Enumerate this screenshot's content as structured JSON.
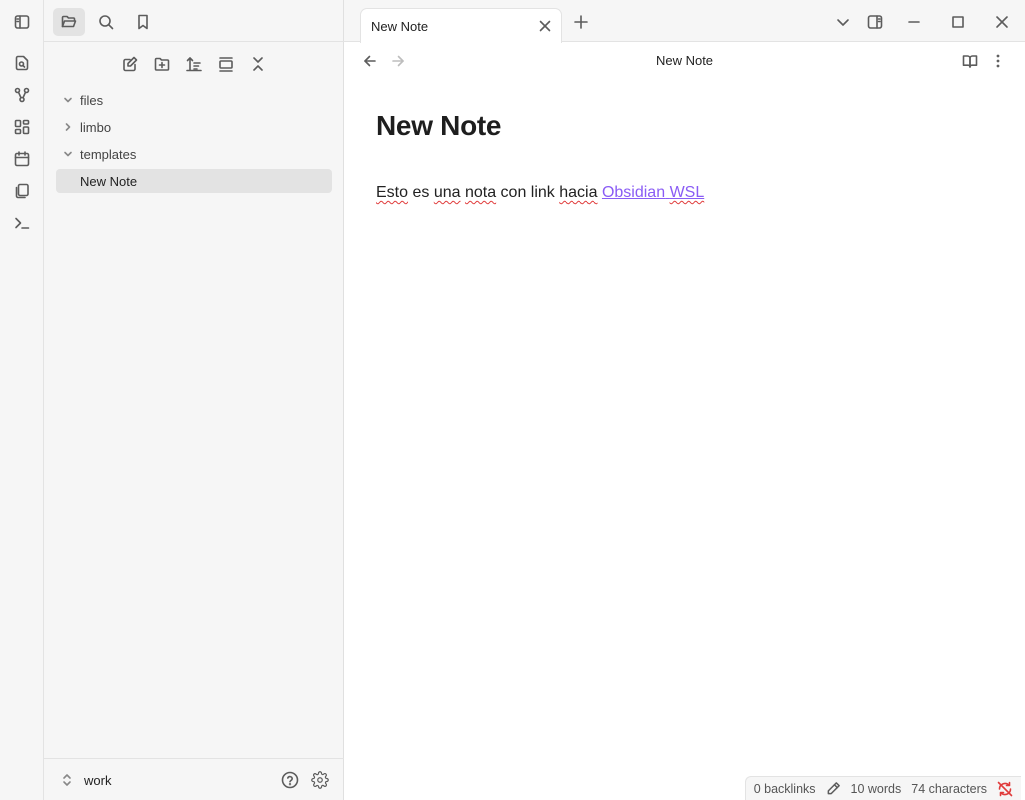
{
  "ribbon": {
    "items": [
      {
        "name": "switcher-icon"
      },
      {
        "name": "graph-icon"
      },
      {
        "name": "canvas-icon"
      },
      {
        "name": "daily-note-icon"
      },
      {
        "name": "templates-icon"
      },
      {
        "name": "command-palette-icon"
      }
    ]
  },
  "sidebar": {
    "tree": [
      {
        "label": "files",
        "type": "folder",
        "expanded": true
      },
      {
        "label": "limbo",
        "type": "folder",
        "expanded": false
      },
      {
        "label": "templates",
        "type": "folder",
        "expanded": true
      },
      {
        "label": "New Note",
        "type": "file",
        "active": true
      }
    ],
    "vault": {
      "name": "work"
    }
  },
  "tabbar": {
    "active_tab": "New Note"
  },
  "view": {
    "title": "New Note"
  },
  "note": {
    "heading": "New Note",
    "body_w1": "Esto",
    "body_w2": " es ",
    "body_w3": "una",
    "body_w4": " ",
    "body_w5": "nota",
    "body_w6": " con link ",
    "body_w7": "hacia",
    "body_w8": " ",
    "link_w1": "Obsidian",
    "link_w2": " ",
    "link_w3": "WSL"
  },
  "status": {
    "backlinks": "0 backlinks",
    "words": "10 words",
    "characters": "74 characters"
  },
  "colors": {
    "accent": "#8a5cf5",
    "spellcheck": "#e03b3b",
    "sync_error": "#e03b3b"
  }
}
